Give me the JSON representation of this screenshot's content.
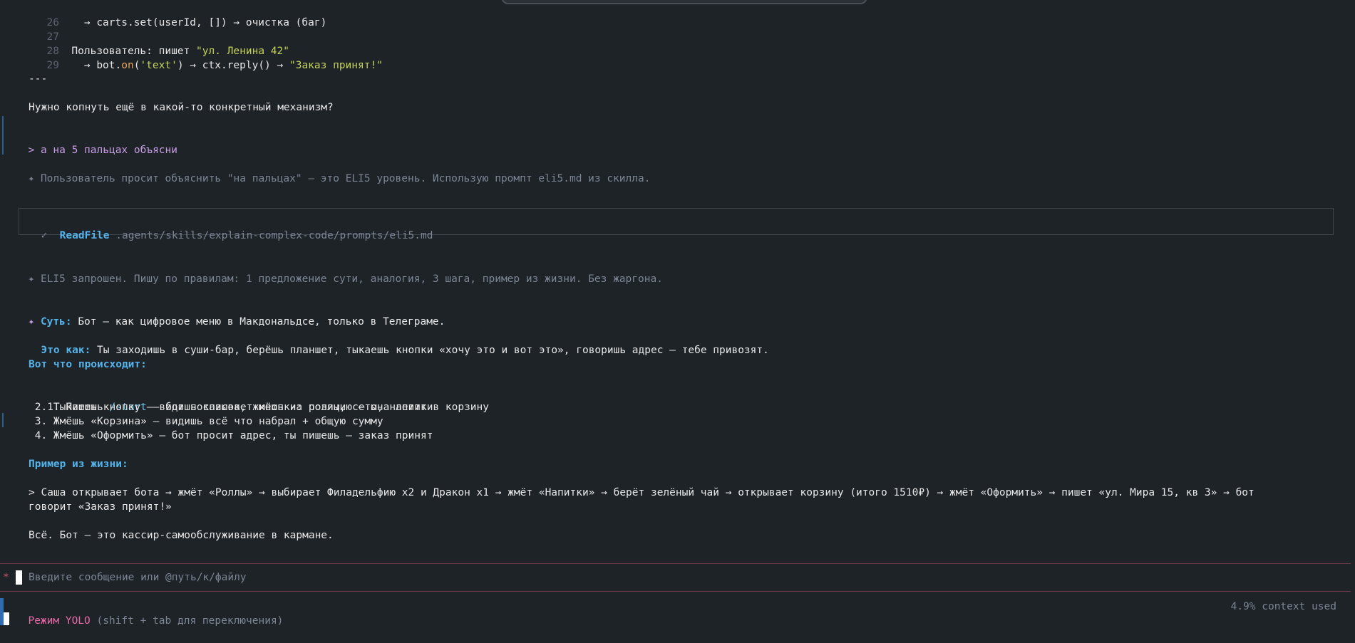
{
  "code": {
    "lines": [
      {
        "num": "26",
        "text": "  → carts.set(userId, []) → очистка (баг)"
      },
      {
        "num": "27",
        "text": ""
      },
      {
        "num": "28",
        "prefix": "Пользователь: пишет ",
        "str": "\"ул. Ленина 42\""
      },
      {
        "num": "29",
        "p1": "  → bot.",
        "fn": "on",
        "p2": "(",
        "arg": "'text'",
        "p3": ") → ctx.reply() → ",
        "str": "\"Заказ принят!\""
      }
    ]
  },
  "separator": "---",
  "question": "Нужно копнуть ещё в какой-то конкретный механизм?",
  "user_prompt": {
    "marker": ">",
    "text": "а на 5 пальцах объясни"
  },
  "thought1": "Пользователь просит объяснить \"на пальцах\" — это ELI5 уровень. Использую промпт eli5.md из скилла.",
  "tool_call": {
    "check": "✓",
    "name": "ReadFile",
    "path": ".agents/skills/explain-complex-code/prompts/eli5.md"
  },
  "thought2": "ELI5 запрошен. Пишу по правилам: 1 предложение сути, аналогия, 3 шага, пример из жизни. Без жаргона.",
  "answer": {
    "essence_label": "Суть:",
    "essence_text": " Бот — как цифровое меню в Макдональдсе, только в Телеграме.",
    "analogy_label": "Это как:",
    "analogy_text": " Ты заходишь в суши-бар, берёшь планшет, тыкаешь кнопки «хочу это и вот это», говоришь адрес — тебе привозят.",
    "steps_label": "Вот что происходит:",
    "step1_a": " 1. Пишешь ",
    "step1_cmd": "/start",
    "step1_b": " — бот показывает кнопки: роллы, сеты, напитки",
    "step2": " 2. Тыкаешь кнопку — видишь список, жмёшь на позицию — она летит в корзину",
    "step3": " 3. Жмёшь «Корзина» — видишь всё что набрал + общую сумму",
    "step4": " 4. Жмёшь «Оформить» — бот просит адрес, ты пишешь — заказ принят",
    "example_label": "Пример из жизни:",
    "example_line1": "> Саша открывает бота → жмёт «Роллы» → выбирает Филадельфию x2 и Дракон x1 → жмёт «Напитки» → берёт зелёный чай → открывает корзину (итого 1510₽) → жмёт «Оформить» → пишет «ул. Мира 15, кв 3» → бот",
    "example_line2": "говорит «Заказ принят!»",
    "conclusion": "Всё. Бот — это кассир-самообслуживание в кармане."
  },
  "input": {
    "prompt_marker": "*",
    "placeholder": "Введите сообщение или @путь/к/файлу"
  },
  "status": {
    "mode_label": "Режим YOLO",
    "mode_hint": " (shift + tab для переключения)",
    "context": "4.9% context used"
  },
  "colors": {
    "background": "#1e2328",
    "accent_blue": "#53b4ec",
    "string_yellow": "#c4d35a",
    "user_purple": "#c79de3",
    "mode_pink": "#e86aa8"
  }
}
